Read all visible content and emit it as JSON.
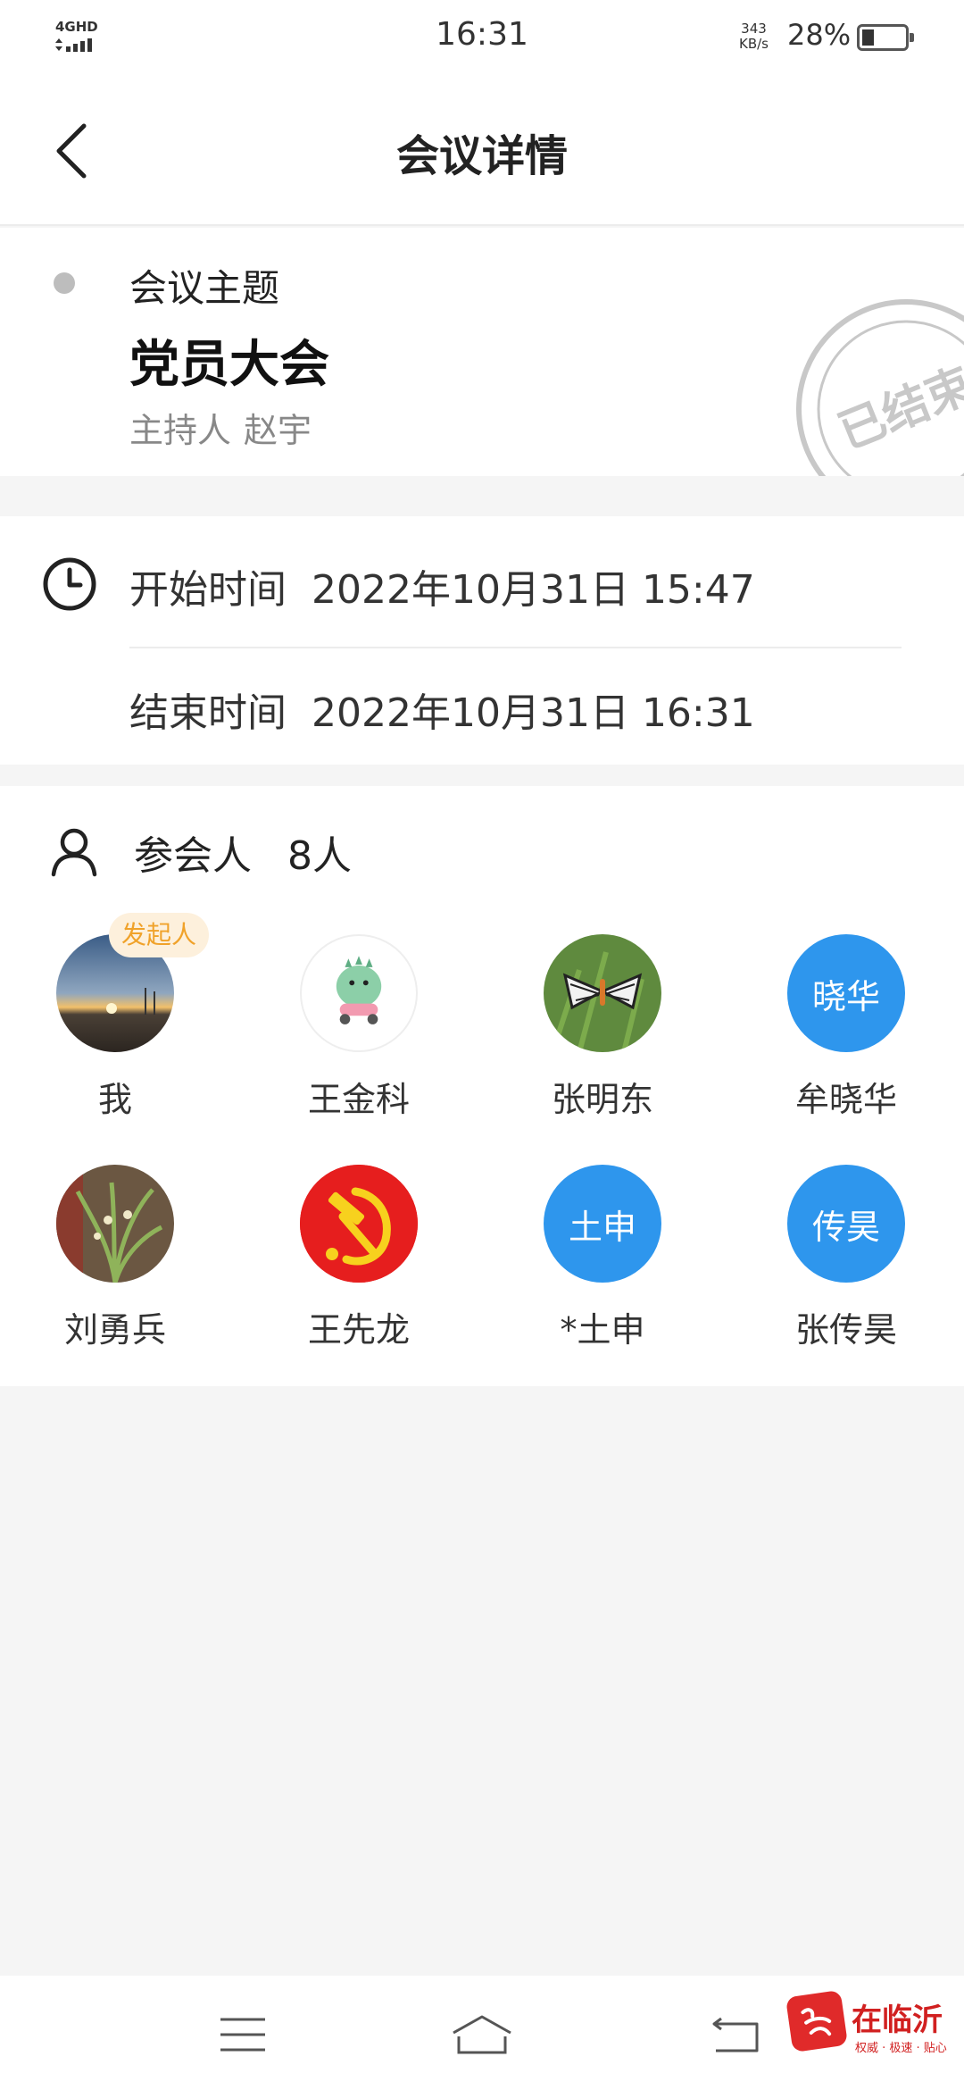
{
  "status_bar": {
    "network": "4GHD",
    "time": "16:31",
    "speed_value": "343",
    "speed_unit": "KB/s",
    "battery": "28%",
    "battery_level": 0.28
  },
  "header": {
    "title": "会议详情",
    "back_icon": "chevron-left-icon"
  },
  "topic": {
    "label": "会议主题",
    "title": "党员大会",
    "host_label": "主持人",
    "host_name": "赵宇",
    "stamp_text": "已结束"
  },
  "times": {
    "start_label": "开始时间",
    "start_value": "2022年10月31日 15:47",
    "end_label": "结束时间",
    "end_value": "2022年10月31日 16:31"
  },
  "participants": {
    "label": "参会人",
    "count": "8人",
    "initiator_badge": "发起人",
    "members": [
      {
        "name": "我",
        "avatar": "sunset-photo"
      },
      {
        "name": "王金科",
        "avatar": "dinosaur-cartoon"
      },
      {
        "name": "张明东",
        "avatar": "butterfly-photo"
      },
      {
        "name": "牟晓华",
        "avatar_text": "晓华"
      },
      {
        "name": "刘勇兵",
        "avatar": "plant-photo"
      },
      {
        "name": "王先龙",
        "avatar": "party-emblem"
      },
      {
        "name": "*土申",
        "avatar_text": "土申"
      },
      {
        "name": "张传昊",
        "avatar_text": "传昊"
      }
    ]
  },
  "system_nav": {
    "menu_icon": "menu-icon",
    "home_icon": "home-icon",
    "back_icon": "return-icon"
  },
  "watermark": {
    "name": "在临沂",
    "tagline": "权威 · 极速 · 贴心"
  },
  "colors": {
    "accent_blue": "#2e96ed",
    "badge_bg": "#fdf0dc",
    "badge_text": "#f0a22a",
    "page_bg": "#f5f5f5"
  }
}
